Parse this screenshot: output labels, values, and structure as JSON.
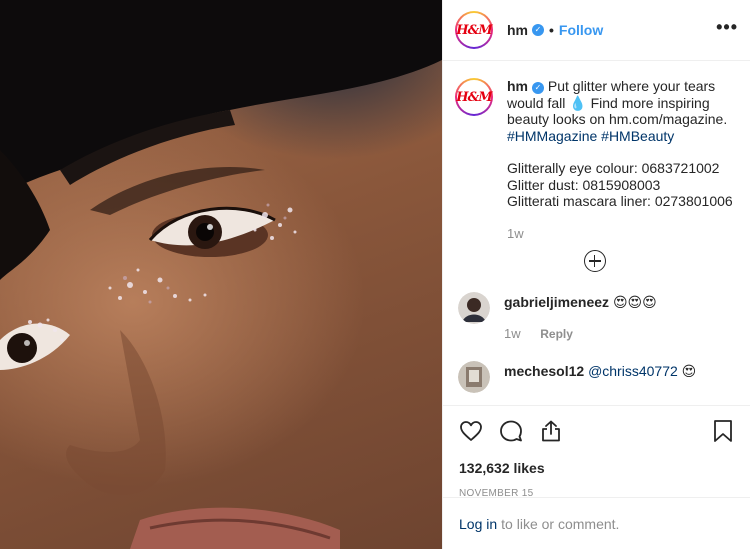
{
  "post": {
    "image_alt": "Close-up of a face with glitter eye makeup"
  },
  "header": {
    "username": "hm",
    "verified_icon": "verified-badge-icon",
    "separator": "•",
    "follow_label": "Follow",
    "more_icon": "ellipsis-icon",
    "avatar_logo": "H&M"
  },
  "caption": {
    "username": "hm",
    "line1": "Put glitter where your tears would fall 💧 Find more inspiring beauty looks on hm.com/magazine.",
    "hashtags": "#HMMagazine #HMBeauty",
    "item1": "Glitterally eye colour: 0683721002",
    "item2": "Glitter dust: 0815908003",
    "item3": "Glitterati mascara liner: 0273801006",
    "time": "1w"
  },
  "load_more_icon": "add-circle-icon",
  "comments": [
    {
      "username": "gabrieljimeneez",
      "text": "😍😍😍",
      "time": "1w",
      "reply_label": "Reply"
    },
    {
      "username": "mechesol12",
      "mention": "@chriss40772",
      "text": "😍"
    }
  ],
  "actions": {
    "like_icon": "heart-icon",
    "comment_icon": "comment-icon",
    "share_icon": "share-icon",
    "save_icon": "bookmark-icon"
  },
  "likes": "132,632 likes",
  "date": "NOVEMBER 15",
  "login": {
    "link": "Log in",
    "rest": "to like or comment."
  },
  "colors": {
    "link_blue": "#3897f0",
    "tag_blue": "#003569",
    "muted": "#8e8e8e",
    "brand_red": "#e50010"
  }
}
